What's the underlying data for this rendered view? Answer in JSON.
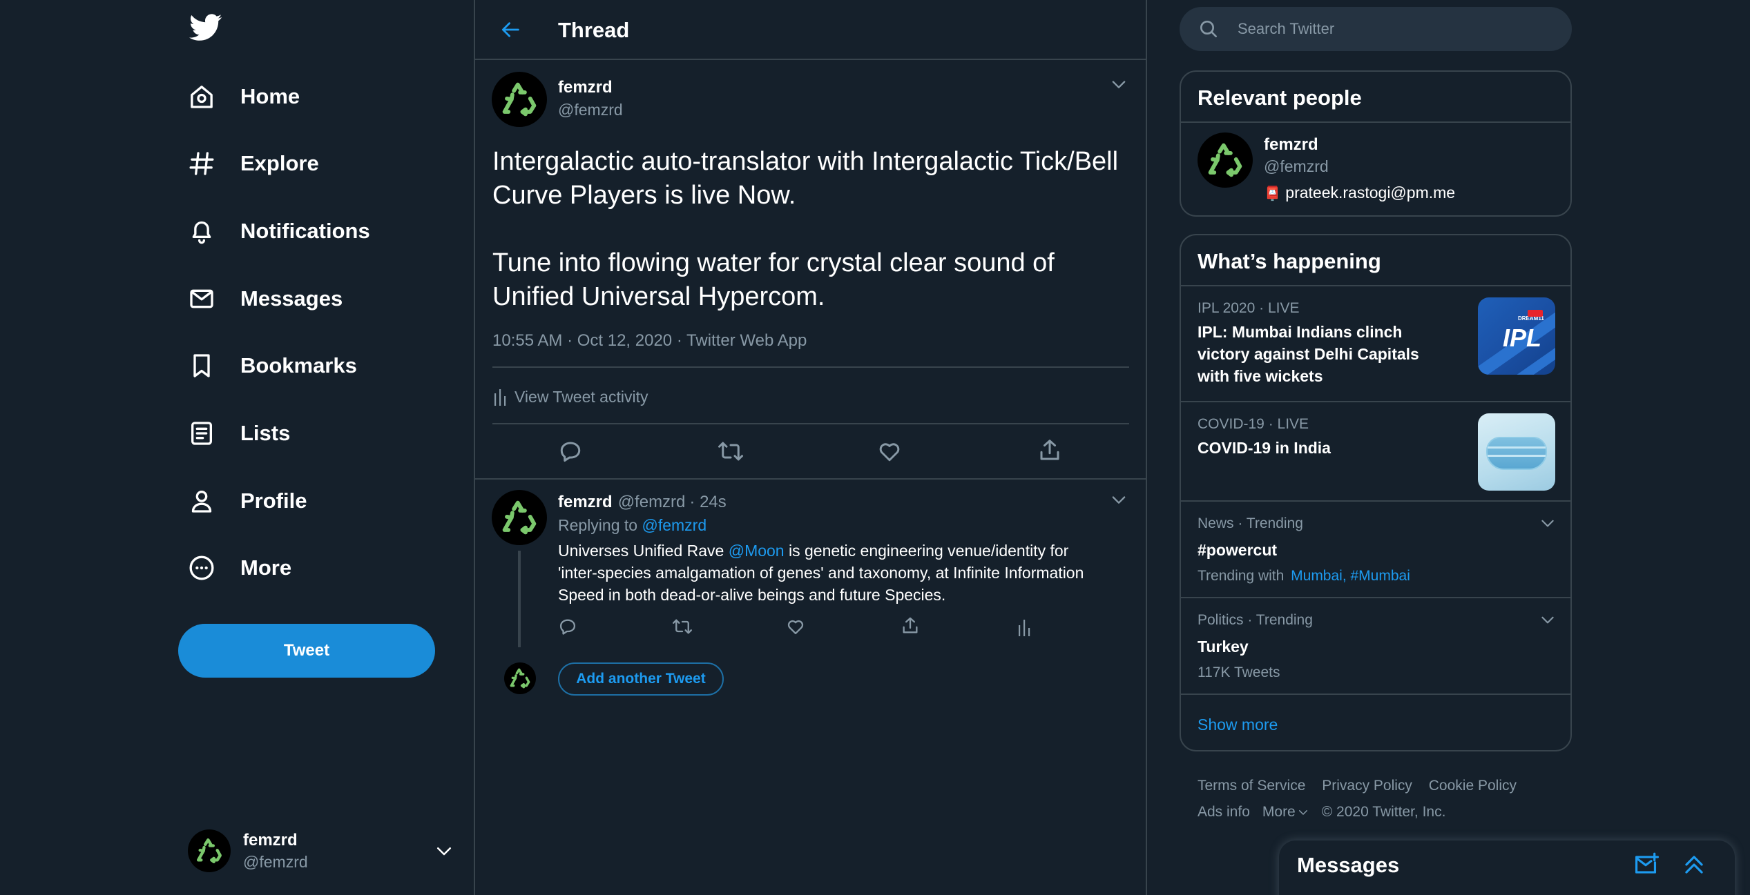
{
  "nav": {
    "logo": "twitter-bird",
    "items": [
      {
        "label": "Home",
        "icon": "home-icon"
      },
      {
        "label": "Explore",
        "icon": "hashtag-icon"
      },
      {
        "label": "Notifications",
        "icon": "bell-icon"
      },
      {
        "label": "Messages",
        "icon": "envelope-icon"
      },
      {
        "label": "Bookmarks",
        "icon": "bookmark-icon"
      },
      {
        "label": "Lists",
        "icon": "list-icon"
      },
      {
        "label": "Profile",
        "icon": "person-icon"
      },
      {
        "label": "More",
        "icon": "more-circle-icon"
      }
    ],
    "tweet_button": "Tweet",
    "account": {
      "name": "femzrd",
      "handle": "@femzrd"
    }
  },
  "thread": {
    "header_title": "Thread",
    "main_tweet": {
      "name": "femzrd",
      "handle": "@femzrd",
      "text_line1": "Intergalactic auto-translator with Intergalactic Tick/Bell",
      "text_line2": "Curve Players is live Now.",
      "text_line3": "Tune into flowing water for crystal clear sound of",
      "text_line4": "Unified Universal Hypercom.",
      "meta": "10:55 AM · Oct 12, 2020 · Twitter Web App",
      "activity": "View Tweet activity"
    },
    "reply": {
      "name": "femzrd",
      "handle": "@femzrd",
      "time": "· 24s",
      "replying_prefix": "Replying to",
      "replying_to": "@femzrd",
      "text_part1": "Universes Unified Rave",
      "mention": "@Moon",
      "text_part2": "is genetic engineering venue/identity for",
      "text_line2": "'inter-species amalgamation of genes' and taxonomy, at Infinite Information",
      "text_line3": "Speed in both dead-or-alive beings and future Species."
    },
    "add_tweet": "Add another Tweet"
  },
  "search": {
    "placeholder": "Search Twitter"
  },
  "relevant_people": {
    "title": "Relevant people",
    "person": {
      "name": "femzrd",
      "handle": "@femzrd",
      "email": "prateek.rastogi@pm.me",
      "email_emoji": "📮"
    }
  },
  "whats_happening": {
    "title": "What’s happening",
    "trends": [
      {
        "meta": "IPL 2020 · LIVE",
        "title_l1": "IPL: Mumbai Indians clinch",
        "title_l2": "victory against Delhi Capitals",
        "title_l3": "with five wickets",
        "thumb": "ipl-logo"
      },
      {
        "meta": "COVID-19 · LIVE",
        "title_l1": "COVID-19 in India",
        "thumb": "face-mask"
      },
      {
        "meta": "News · Trending",
        "title_l1": "#powercut",
        "sub_prefix": "Trending with",
        "sub_links": "Mumbai, #Mumbai"
      },
      {
        "meta": "Politics · Trending",
        "title_l1": "Turkey",
        "sub": "117K Tweets"
      }
    ],
    "show_more": "Show more",
    "ipl_badge_text": "IPL",
    "ipl_small_text": "DREAM11"
  },
  "footer": {
    "terms": "Terms of Service",
    "privacy": "Privacy Policy",
    "cookie": "Cookie Policy",
    "ads": "Ads info",
    "more": "More",
    "copyright": "© 2020 Twitter, Inc."
  },
  "messages_drawer": {
    "title": "Messages"
  },
  "colors": {
    "background": "#15202b",
    "accent": "#1d9bf0",
    "tweet_button": "#1a8cd8",
    "border": "#38444d",
    "muted": "#8899a6",
    "avatar_symbol": "#7bc86c"
  }
}
